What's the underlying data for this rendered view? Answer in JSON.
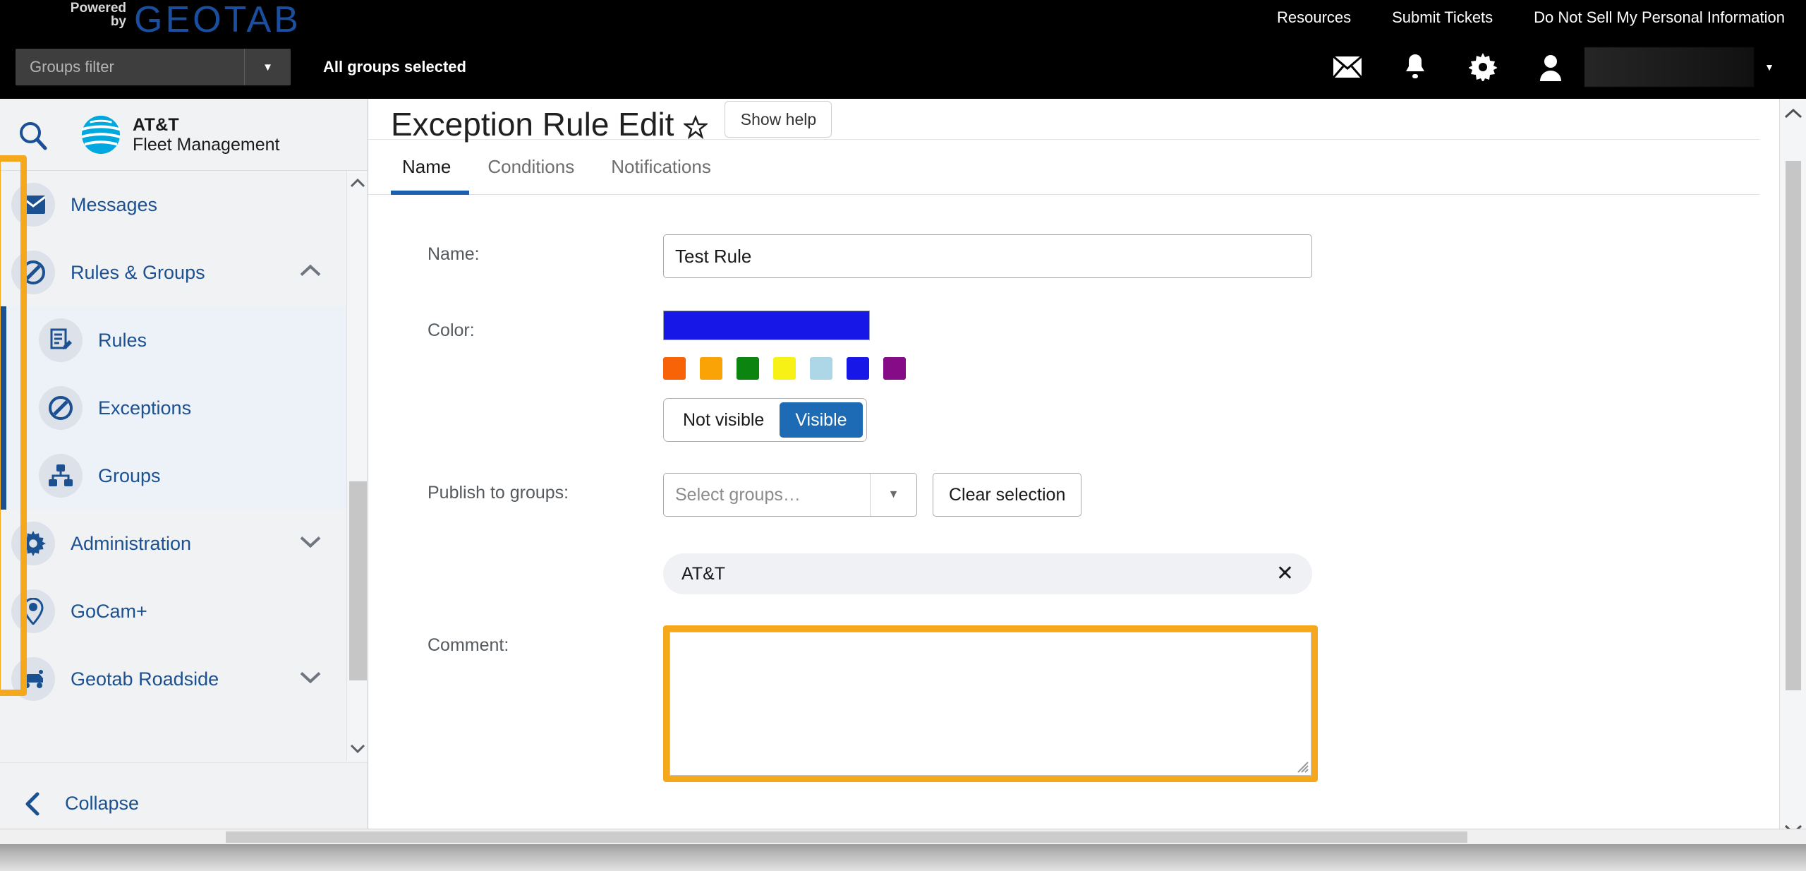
{
  "topbar": {
    "powered_line1": "Powered",
    "powered_line2": "by",
    "brand": "GEOTAB",
    "nav": [
      {
        "label": "Resources"
      },
      {
        "label": "Submit Tickets"
      },
      {
        "label": "Do Not Sell My Personal Information"
      }
    ],
    "groups_filter_placeholder": "Groups filter",
    "groups_status": "All groups selected",
    "icons": [
      "mail-icon",
      "bell-icon",
      "gear-icon",
      "user-icon"
    ],
    "user_name": ""
  },
  "sidebar": {
    "search_icon": "search-icon",
    "brand_line1": "AT&T",
    "brand_line2": "Fleet Management",
    "items": [
      {
        "label": "Messages",
        "icon": "mail-icon",
        "expandable": false
      },
      {
        "label": "Rules & Groups",
        "icon": "rules-icon",
        "expandable": true,
        "chevron": "chevron-up-icon"
      },
      {
        "label": "Rules",
        "icon": "rules-edit-icon",
        "sub": true
      },
      {
        "label": "Exceptions",
        "icon": "exceptions-icon",
        "sub": true
      },
      {
        "label": "Groups",
        "icon": "groups-icon",
        "sub": true
      },
      {
        "label": "Administration",
        "icon": "gear-icon",
        "expandable": true,
        "chevron": "chevron-down-icon"
      },
      {
        "label": "GoCam+",
        "icon": "gocam-icon",
        "expandable": false
      },
      {
        "label": "Geotab Roadside",
        "icon": "roadside-icon",
        "expandable": true,
        "chevron": "chevron-down-icon"
      }
    ],
    "collapse_label": "Collapse"
  },
  "page": {
    "title": "Exception Rule Edit",
    "favorite_icon": "star-icon",
    "show_help_label": "Show help",
    "tabs": [
      {
        "label": "Name",
        "active": true
      },
      {
        "label": "Conditions",
        "active": false
      },
      {
        "label": "Notifications",
        "active": false
      }
    ]
  },
  "form": {
    "name_label": "Name:",
    "name_value": "Test Rule",
    "name_placeholder": "",
    "color_label": "Color:",
    "selected_color": "#1717E8",
    "palette": [
      {
        "name": "orange-red",
        "hex": "#F96307"
      },
      {
        "name": "amber",
        "hex": "#F9A307"
      },
      {
        "name": "green",
        "hex": "#0C8410"
      },
      {
        "name": "yellow",
        "hex": "#F7F116"
      },
      {
        "name": "light-blue",
        "hex": "#ADD7E6"
      },
      {
        "name": "blue",
        "hex": "#1717E8"
      },
      {
        "name": "purple",
        "hex": "#860B86"
      }
    ],
    "visibility": {
      "not_visible_label": "Not visible",
      "visible_label": "Visible",
      "selected": "Visible"
    },
    "publish_label": "Publish to groups:",
    "select_groups_placeholder": "Select groups…",
    "clear_selection_label": "Clear selection",
    "selected_groups": [
      {
        "name": "AT&T",
        "remove_icon": "close-icon"
      }
    ],
    "comment_label": "Comment:",
    "comment_value": "",
    "comment_placeholder": ""
  },
  "highlights": {
    "accent_hex": "#F5A81C"
  }
}
